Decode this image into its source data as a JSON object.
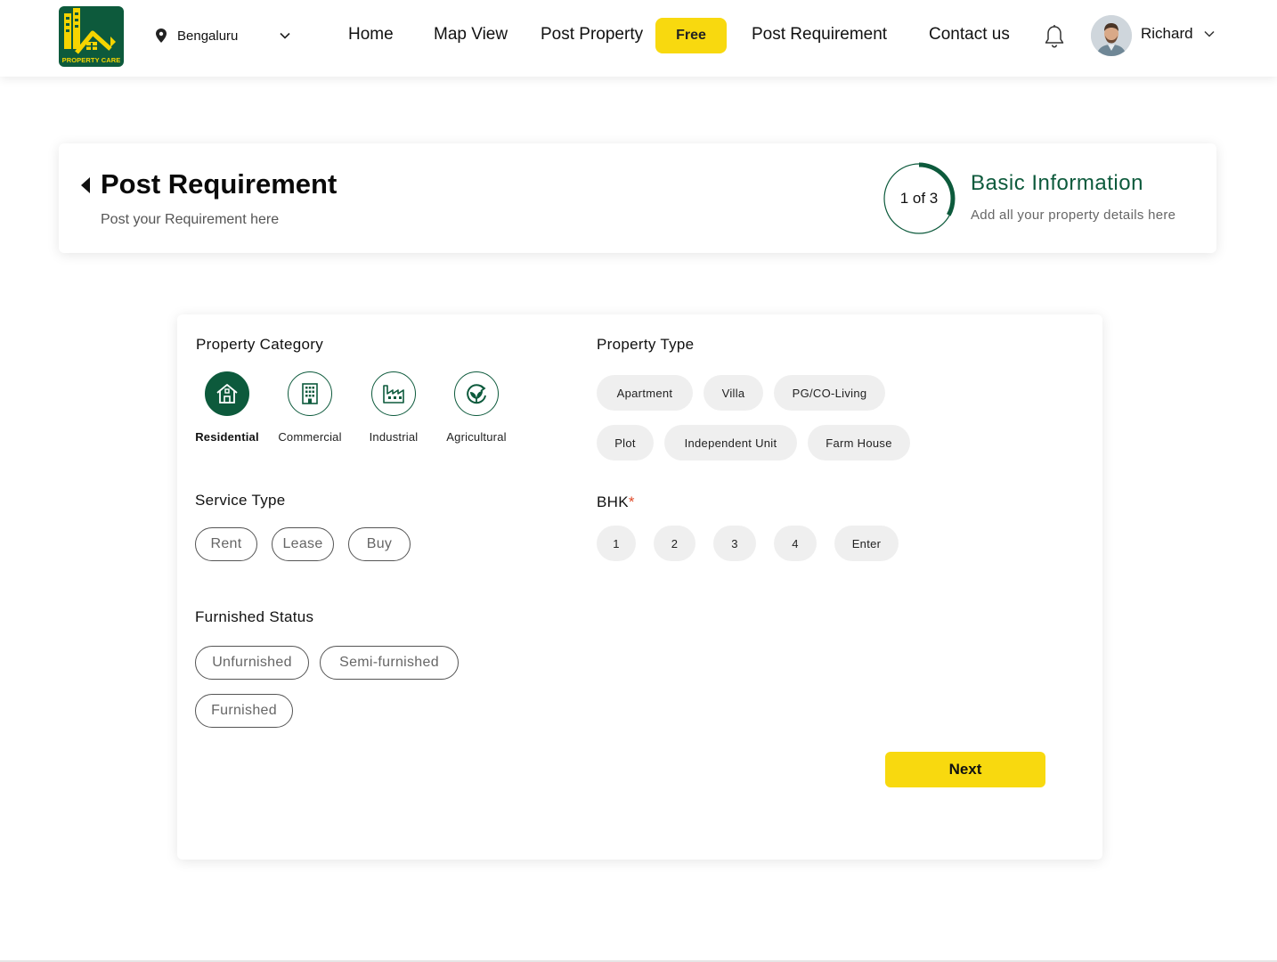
{
  "header": {
    "logo_text": "PROPERTY CARE",
    "location": "Bengaluru",
    "nav": {
      "home": "Home",
      "map_view": "Map View",
      "post_property": "Post Property",
      "free_badge": "Free",
      "post_requirement": "Post Requirement",
      "contact_us": "Contact us"
    },
    "user_name": "Richard"
  },
  "step_card": {
    "title": "Post Requirement",
    "subtitle": "Post your Requirement here",
    "progress_text": "1 of 3",
    "progress_fraction": 0.33,
    "step_title": "Basic Information",
    "step_subtitle": "Add all your property details here"
  },
  "form": {
    "property_category": {
      "label": "Property Category",
      "options": [
        "Residential",
        "Commercial",
        "Industrial",
        "Agricultural"
      ],
      "selected": "Residential"
    },
    "property_type": {
      "label": "Property Type",
      "options": [
        "Apartment",
        "Villa",
        "PG/CO-Living",
        "Plot",
        "Independent Unit",
        "Farm House"
      ]
    },
    "service_type": {
      "label": "Service Type",
      "options": [
        "Rent",
        "Lease",
        "Buy"
      ]
    },
    "bhk": {
      "label": "BHK",
      "required_mark": "*",
      "options": [
        "1",
        "2",
        "3",
        "4",
        "Enter"
      ]
    },
    "furnished_status": {
      "label": "Furnished Status",
      "options": [
        "Unfurnished",
        "Semi-furnished",
        "Furnished"
      ]
    },
    "next_label": "Next"
  },
  "colors": {
    "brand_green": "#0d5a3c",
    "accent_yellow": "#f8d90f",
    "required_red": "#e04b2a"
  }
}
